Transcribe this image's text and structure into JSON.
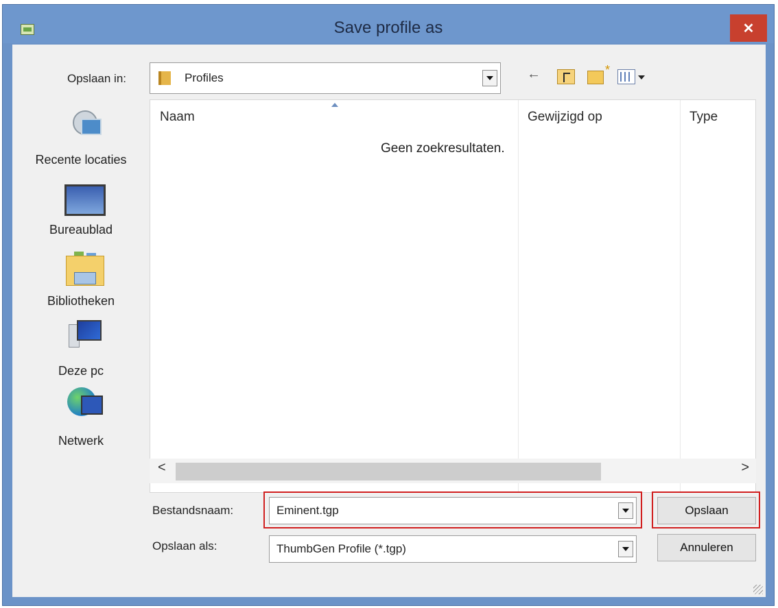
{
  "window": {
    "title": "Save profile as",
    "close_glyph": "✕"
  },
  "toolbar": {
    "save_in_label": "Opslaan in:",
    "save_in_value": "Profiles",
    "back_glyph": "←"
  },
  "places": [
    {
      "label": "Recente locaties",
      "icon": "recent-locations-icon"
    },
    {
      "label": "Bureaublad",
      "icon": "desktop-icon"
    },
    {
      "label": "Bibliotheken",
      "icon": "libraries-icon"
    },
    {
      "label": "Deze pc",
      "icon": "this-pc-icon"
    },
    {
      "label": "Netwerk",
      "icon": "network-icon"
    }
  ],
  "list": {
    "columns": [
      "Naam",
      "Gewijzigd op",
      "Type"
    ],
    "empty_message": "Geen zoekresultaten.",
    "scroll_left": "<",
    "scroll_right": ">"
  },
  "form": {
    "filename_label": "Bestandsnaam:",
    "filename_value": "Eminent.tgp",
    "savetype_label": "Opslaan als:",
    "savetype_value": "ThumbGen Profile (*.tgp)",
    "save_button": "Opslaan",
    "cancel_button": "Annuleren"
  },
  "colors": {
    "title_bar": "#6e97cd",
    "close_button": "#c8402e",
    "highlight": "#d11f1f"
  }
}
